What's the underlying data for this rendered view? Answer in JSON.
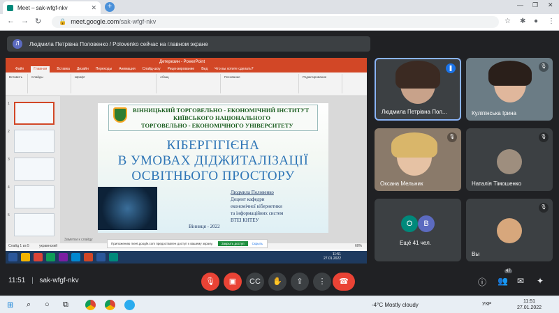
{
  "browser": {
    "tab_title": "Meet – sak-wfgf-nkv",
    "url_host": "meet.google.com",
    "url_path": "/sak-wfgf-nkv"
  },
  "banner": {
    "avatar_letter": "Л",
    "text": "Людмила Петрівна Половенко / Polovenko сейчас на главном экране"
  },
  "powerpoint": {
    "title": "Детерезин - PowerPoint",
    "tabs": [
      "Файл",
      "Главная",
      "Вставка",
      "Дизайн",
      "Переходы",
      "Анимация",
      "Слайд-шоу",
      "Рецензирование",
      "Вид",
      "Что вы хотите сделать?"
    ],
    "ribbon_groups": [
      "Вставить",
      "Слайды",
      "Шрифт",
      "Абзац",
      "Рисование",
      "Редактирование"
    ],
    "slide_numbers": [
      "1",
      "2",
      "3",
      "4",
      "5"
    ],
    "notes": "Заметки к слайду",
    "status_left": "Слайд 1 из 5",
    "status_lang": "украинский",
    "zoom": "60%",
    "share_notice": "Приложению meet.google.com предоставлен доступ к вашему экрану.",
    "share_stop": "Закрыть доступ",
    "share_hide": "Скрыть",
    "clock_time": "11:51",
    "clock_date": "27.01.2022"
  },
  "slide": {
    "inst_line1": "ВІННИЦЬКИЙ ТОРГОВЕЛЬНО - ЕКОНОМІЧНИЙ ІНСТИТУТ",
    "inst_line2": "КИЇВСЬКОГО НАЦІОНАЛЬНОГО",
    "inst_line3": "ТОРГОВЕЛЬНО - ЕКОНОМІЧНОГО УНІВЕРСИТЕТУ",
    "title_line1": "КІБЕРГІГІЄНА",
    "title_line2": "В УМОВАХ ДІДЖИТАЛІЗАЦІЇ",
    "title_line3": "ОСВІТНЬОГО ПРОСТОРУ",
    "author_name": "Людмила Половенко",
    "author_line2": "Доцент кафедри",
    "author_line3": "економічної кібернетики",
    "author_line4": "та інформаційних систем",
    "author_line5": "ВТЕІ КНТЕУ",
    "city_year": "Вінниця - 2022"
  },
  "participants": [
    {
      "name": "Людмила Петрівна Пол...",
      "mic": "speaking"
    },
    {
      "name": "Куліпінська Ірина",
      "mic": "muted"
    },
    {
      "name": "Оксана Мельник",
      "mic": "muted"
    },
    {
      "name": "Наталія Тімошенко",
      "mic": "muted"
    },
    {
      "name": "Ещё 41 чел.",
      "avatars": [
        "O",
        "B"
      ]
    },
    {
      "name": "Вы",
      "mic": "muted"
    }
  ],
  "meet_bar": {
    "time": "11:51",
    "separator": "|",
    "meeting_code": "sak-wfgf-nkv",
    "participants_count": "47"
  },
  "taskbar": {
    "weather": "-4°C  Mostly cloudy",
    "lang": "УКР",
    "time": "11:51",
    "date": "27.01.2022"
  },
  "colors": {
    "meet_bg": "#202124",
    "tile_bg": "#3c4043",
    "end_call": "#ea4335",
    "ppt_brand": "#d24726",
    "slide_title": "#2e75b6"
  }
}
